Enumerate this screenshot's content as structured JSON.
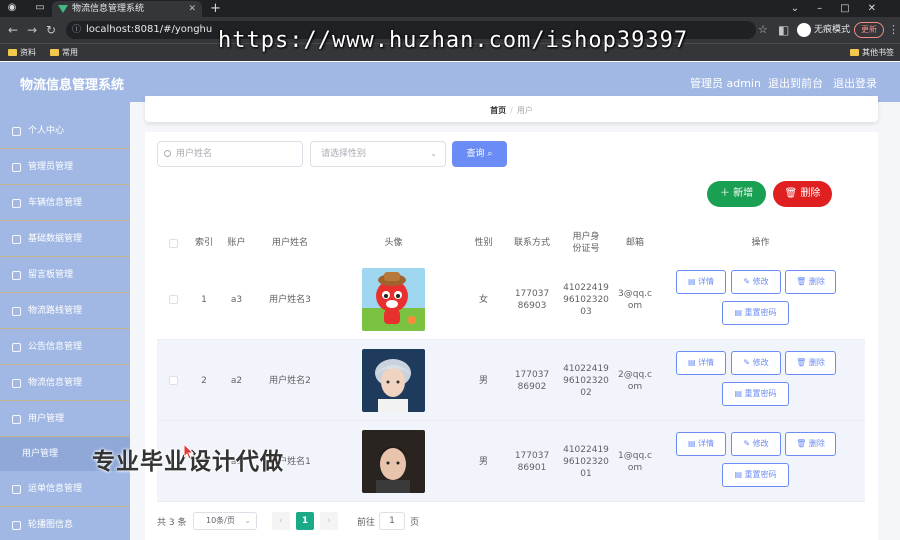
{
  "browser": {
    "tab_title": "物流信息管理系统",
    "url": "localhost:8081/#/yonghu",
    "profile_label": "无痕模式",
    "update_label": "更新",
    "bookmarks": [
      "资料",
      "常用",
      "其他书签"
    ],
    "watermark": "https://www.huzhan.com/ishop39397"
  },
  "header": {
    "title": "物流信息管理系统",
    "admin_label": "管理员 admin",
    "back_label": "退出到前台",
    "logout_label": "退出登录"
  },
  "sidebar": {
    "items": [
      {
        "label": "个人中心"
      },
      {
        "label": "管理员管理"
      },
      {
        "label": "车辆信息管理"
      },
      {
        "label": "基础数据管理"
      },
      {
        "label": "留言板管理"
      },
      {
        "label": "物流路线管理"
      },
      {
        "label": "公告信息管理"
      },
      {
        "label": "物流信息管理"
      },
      {
        "label": "用户管理"
      },
      {
        "label": "运单信息管理"
      },
      {
        "label": "轮播图信息"
      }
    ],
    "sub_item": "用户管理"
  },
  "breadcrumb": {
    "home": "首页",
    "separator": "/",
    "current": "用户"
  },
  "search": {
    "name_placeholder": "用户姓名",
    "gender_placeholder": "请选择性别",
    "query_label": "查询"
  },
  "actions": {
    "add_label": "新增",
    "delete_label": "删除"
  },
  "table": {
    "headers": [
      "索引",
      "账户",
      "用户姓名",
      "头像",
      "性别",
      "联系方式",
      "用户身份证号",
      "邮箱",
      "操作"
    ],
    "rows": [
      {
        "index": "1",
        "account": "a3",
        "name": "用户姓名3",
        "gender": "女",
        "phone": "17703786903",
        "id_card": "410224199610232003",
        "email": "3@qq.com"
      },
      {
        "index": "2",
        "account": "a2",
        "name": "用户姓名2",
        "gender": "男",
        "phone": "17703786902",
        "id_card": "410224199610232002",
        "email": "2@qq.com"
      },
      {
        "index": "3",
        "account": "a1",
        "name": "用户姓名1",
        "gender": "男",
        "phone": "17703786901",
        "id_card": "410224199610232001",
        "email": "1@qq.com"
      }
    ],
    "op_labels": {
      "detail": "详情",
      "edit": "修改",
      "delete": "删除",
      "reset": "重置密码"
    }
  },
  "pagination": {
    "total": "共 3 条",
    "page_size": "10条/页",
    "current": "1",
    "goto_label": "前往",
    "goto_value": "1",
    "page_label": "页"
  },
  "overlay_text": "专业毕业设计代做",
  "colors": {
    "header_bg": "#a1b8e4",
    "primary": "#6b8cf5",
    "success": "#1aa052",
    "danger": "#e02020",
    "pager_active": "#1aaa87"
  }
}
